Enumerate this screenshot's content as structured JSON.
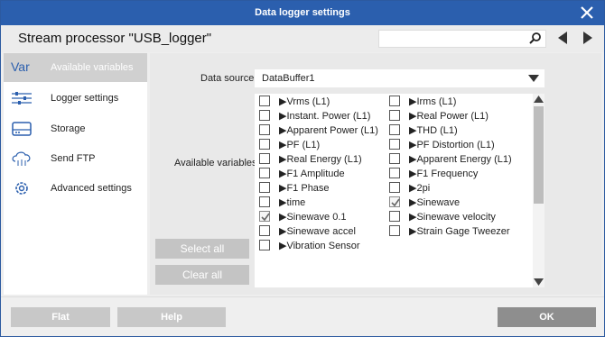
{
  "window": {
    "title": "Data logger settings"
  },
  "header": {
    "heading": "Stream processor \"USB_logger\"",
    "search_value": "",
    "search_placeholder": ""
  },
  "sidebar": {
    "items": [
      {
        "label": "Available variables",
        "icon": "var-icon",
        "active": true
      },
      {
        "label": "Logger settings",
        "icon": "sliders-icon",
        "active": false
      },
      {
        "label": "Storage",
        "icon": "drive-icon",
        "active": false
      },
      {
        "label": "Send FTP",
        "icon": "cloud-upload-icon",
        "active": false
      },
      {
        "label": "Advanced settings",
        "icon": "gear-icon",
        "active": false
      }
    ],
    "var_icon_text": "Var"
  },
  "content": {
    "data_source_label": "Data source",
    "data_source_value": "DataBuffer1",
    "available_label": "Available variables",
    "select_all": "Select all",
    "clear_all": "Clear all",
    "variables": [
      {
        "label": "▶Vrms (L1)",
        "checked": false
      },
      {
        "label": "▶Irms (L1)",
        "checked": false
      },
      {
        "label": "▶Instant. Power (L1)",
        "checked": false
      },
      {
        "label": "▶Real Power (L1)",
        "checked": false
      },
      {
        "label": "▶Apparent Power (L1)",
        "checked": false
      },
      {
        "label": "▶THD (L1)",
        "checked": false
      },
      {
        "label": "▶PF (L1)",
        "checked": false
      },
      {
        "label": "▶PF Distortion (L1)",
        "checked": false
      },
      {
        "label": "▶Real Energy (L1)",
        "checked": false
      },
      {
        "label": "▶Apparent Energy (L1)",
        "checked": false
      },
      {
        "label": "▶F1 Amplitude",
        "checked": false
      },
      {
        "label": "▶F1 Frequency",
        "checked": false
      },
      {
        "label": "▶F1 Phase",
        "checked": false
      },
      {
        "label": "▶2pi",
        "checked": false
      },
      {
        "label": "▶time",
        "checked": false
      },
      {
        "label": "▶Sinewave",
        "checked": true
      },
      {
        "label": "▶Sinewave 0.1",
        "checked": true
      },
      {
        "label": "▶Sinewave velocity",
        "checked": false
      },
      {
        "label": "▶Sinewave accel",
        "checked": false
      },
      {
        "label": "▶Strain Gage Tweezer",
        "checked": false
      },
      {
        "label": "▶Vibration Sensor",
        "checked": false
      }
    ]
  },
  "footer": {
    "flat": "Flat",
    "help": "Help",
    "ok": "OK"
  },
  "colors": {
    "titlebar": "#2b5fae",
    "accent_icon": "#2b5fae",
    "active_nav": "#d0d0d0",
    "button_disabled": "#c4c4c4",
    "button_ok": "#8e8e8e"
  }
}
